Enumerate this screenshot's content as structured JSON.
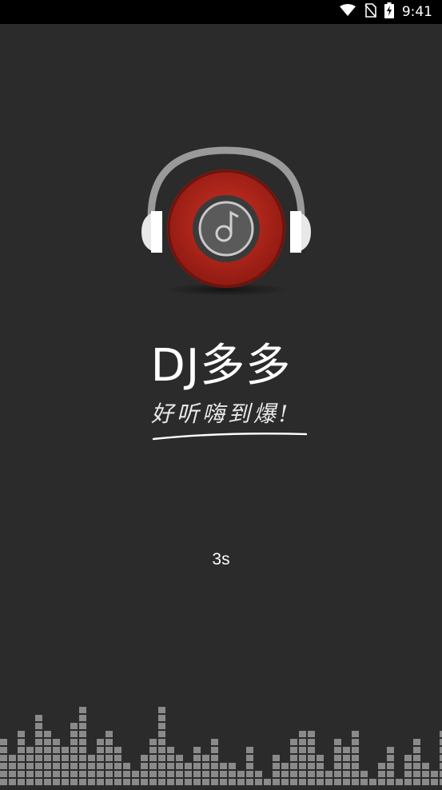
{
  "status_bar": {
    "time": "9:41",
    "icons": [
      "wifi-icon",
      "no-sim-icon",
      "battery-charging-icon"
    ]
  },
  "splash": {
    "app_name": "DJ多多",
    "slogan": "好听嗨到爆!",
    "countdown": "3s"
  },
  "colors": {
    "background": "#2b2b2b",
    "disc_red": "#b3241a",
    "equalizer": "#8a8a8a"
  },
  "decorations": [
    "headphone-logo-icon",
    "equalizer-bars"
  ]
}
